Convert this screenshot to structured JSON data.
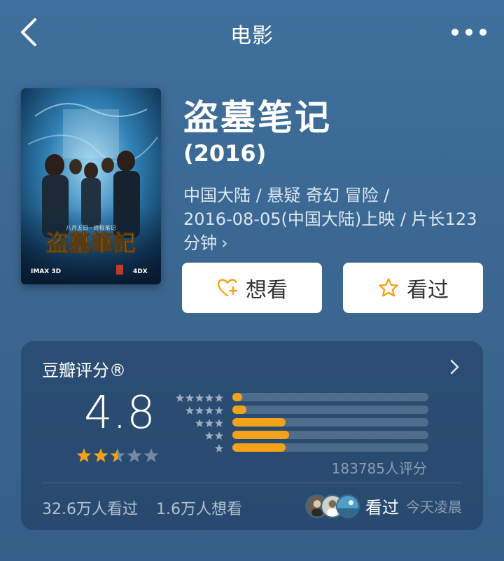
{
  "header": {
    "title": "电影"
  },
  "movie": {
    "title": "盗墓笔记",
    "year": "(2016)",
    "meta_line1": "中国大陆 / 悬疑 奇幻 冒险 /",
    "meta_line2": "2016-08-05(中国大陆)上映 / 片长123",
    "meta_line3": "分钟",
    "meta_chevron": "›"
  },
  "actions": {
    "want_label": "想看",
    "seen_label": "看过"
  },
  "rating": {
    "heading": "豆瓣评分®",
    "score": "4.8",
    "stars_value": 2.5,
    "stars_max": 5,
    "distribution": [
      {
        "stars": 5,
        "fraction": 0.05
      },
      {
        "stars": 4,
        "fraction": 0.07
      },
      {
        "stars": 3,
        "fraction": 0.27
      },
      {
        "stars": 2,
        "fraction": 0.29
      },
      {
        "stars": 1,
        "fraction": 0.27
      }
    ],
    "count_text": "183785人评分",
    "seen_text": "32.6万人看过",
    "want_text": "1.6万人想看",
    "friends_label": "看过",
    "friends_time": "今天凌晨"
  },
  "colors": {
    "accent": "#f3a21a",
    "background": "#3a6690"
  }
}
